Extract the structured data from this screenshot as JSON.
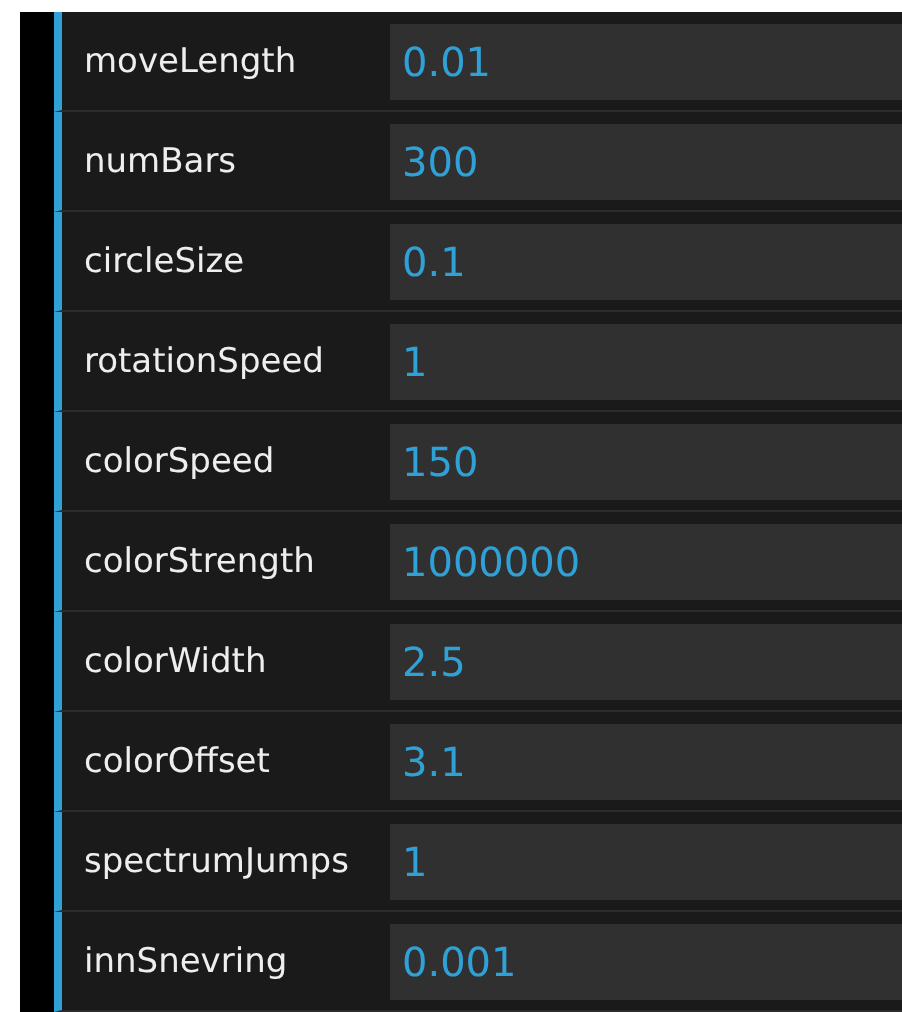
{
  "controllers": [
    {
      "label": "moveLength",
      "value": "0.01"
    },
    {
      "label": "numBars",
      "value": "300"
    },
    {
      "label": "circleSize",
      "value": "0.1"
    },
    {
      "label": "rotationSpeed",
      "value": "1"
    },
    {
      "label": "colorSpeed",
      "value": "150"
    },
    {
      "label": "colorStrength",
      "value": "1000000"
    },
    {
      "label": "colorWidth",
      "value": "2.5"
    },
    {
      "label": "colorOffset",
      "value": "3.1"
    },
    {
      "label": "spectrumJumps",
      "value": "1"
    },
    {
      "label": "innSnevring",
      "value": "0.001"
    }
  ]
}
